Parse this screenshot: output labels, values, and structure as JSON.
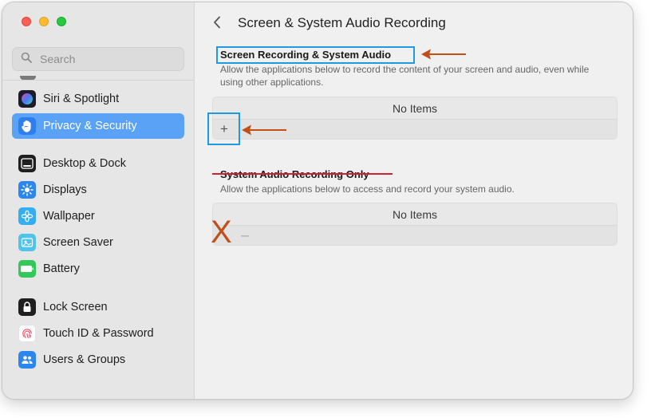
{
  "sidebar": {
    "search_placeholder": "Search",
    "items": [
      {
        "label": "Siri & Spotlight",
        "icon": "siri-icon"
      },
      {
        "label": "Privacy & Security",
        "icon": "hand-icon",
        "selected": true
      },
      {
        "label": "Desktop & Dock",
        "icon": "dock-icon"
      },
      {
        "label": "Displays",
        "icon": "sun-icon"
      },
      {
        "label": "Wallpaper",
        "icon": "flower-icon"
      },
      {
        "label": "Screen Saver",
        "icon": "screen-saver-icon"
      },
      {
        "label": "Battery",
        "icon": "battery-icon"
      },
      {
        "label": "Lock Screen",
        "icon": "lock-icon"
      },
      {
        "label": "Touch ID & Password",
        "icon": "fingerprint-icon"
      },
      {
        "label": "Users & Groups",
        "icon": "users-icon"
      }
    ]
  },
  "main": {
    "title": "Screen & System Audio Recording",
    "sections": [
      {
        "title": "Screen Recording & System Audio",
        "description": "Allow the applications below to record the content of your screen and audio, even while using other applications.",
        "empty_text": "No Items",
        "add_label": "+"
      },
      {
        "title": "System Audio Recording Only",
        "description": "Allow the applications below to access and record your system audio.",
        "empty_text": "No Items",
        "remove_label": "–",
        "cross_mark": "X"
      }
    ]
  },
  "colors": {
    "selection": "#5aa2f5",
    "highlight_box": "#1e9be0",
    "annotation_arrow": "#c0501a",
    "strikethrough": "#cc2233"
  }
}
